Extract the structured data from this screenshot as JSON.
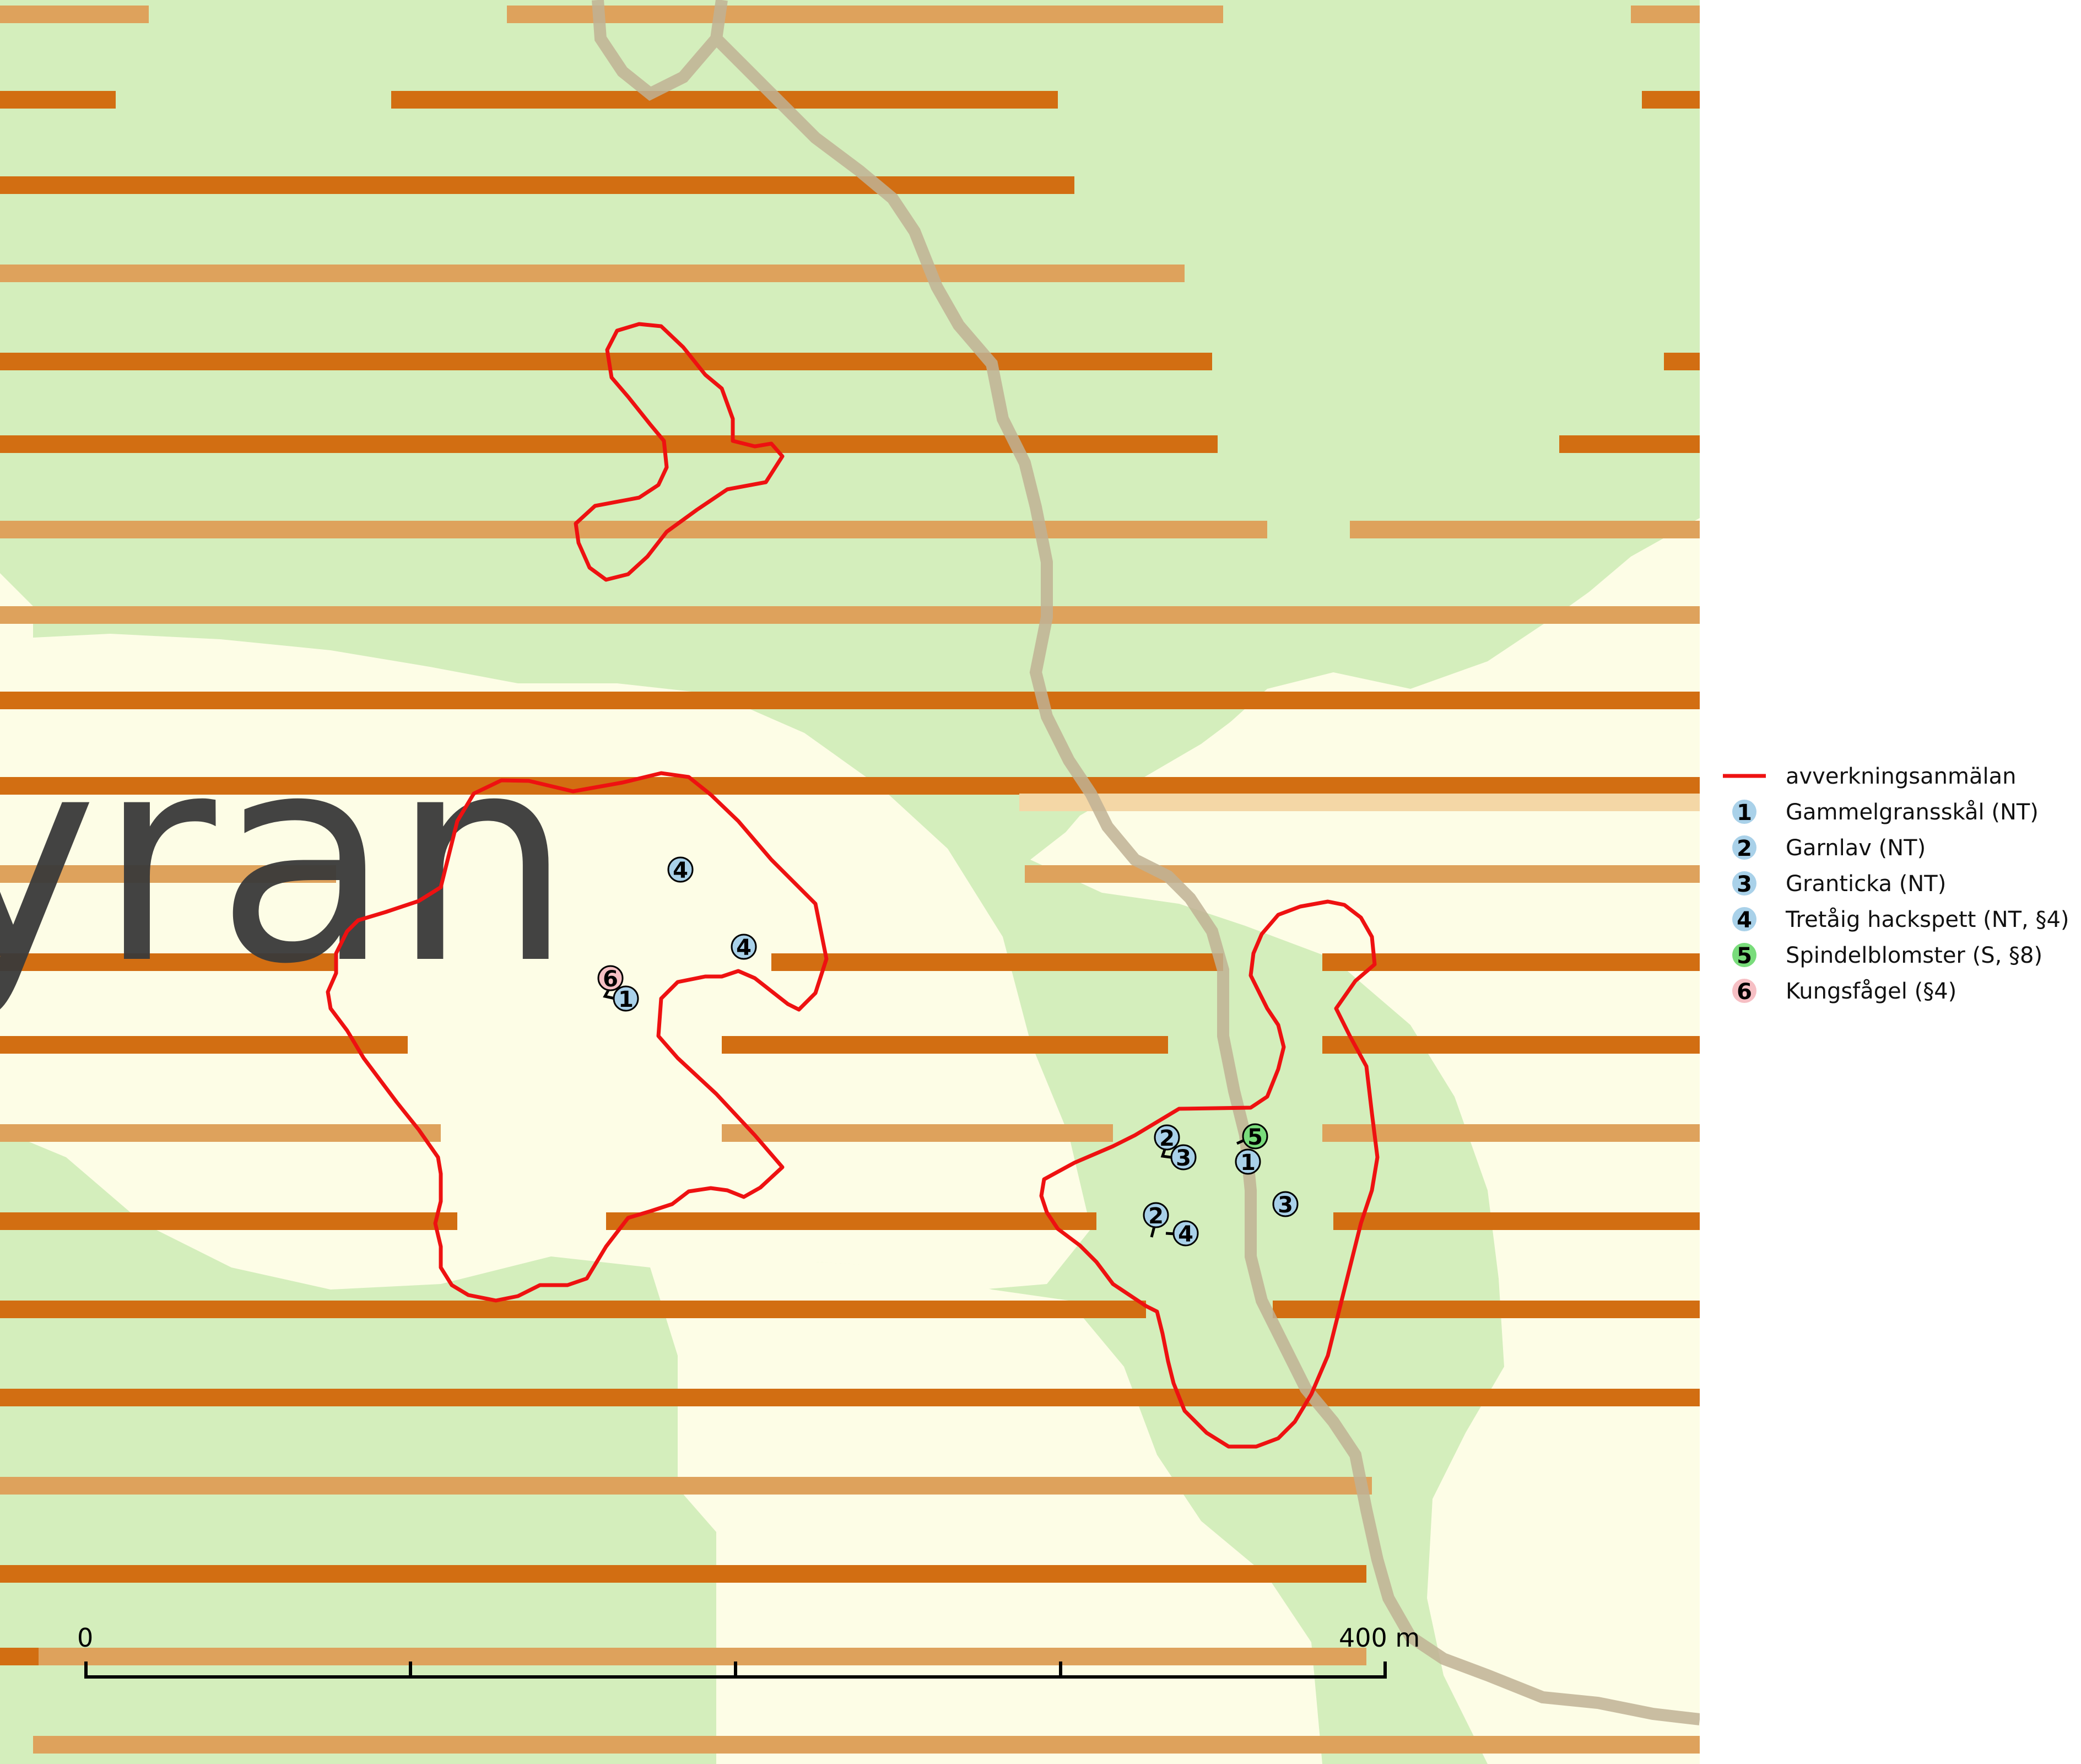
{
  "map": {
    "place_label": "yran",
    "colors": {
      "forest": "#d4eebc",
      "open": "#fdfde6",
      "stripe_dark": "#d26e12",
      "stripe_light": "#dea25c",
      "stripe_pale": "#f4d7a6",
      "path": "#c0b294",
      "boundary": "#ee1111"
    }
  },
  "legend": {
    "items": [
      {
        "symbol": "line",
        "label": "avverkningsanmälan",
        "color": "#ee1111"
      },
      {
        "symbol": "1",
        "label": "Gammelgransskål (NT)",
        "color": "#a9d1e9"
      },
      {
        "symbol": "2",
        "label": "Garnlav (NT)",
        "color": "#a9d1e9"
      },
      {
        "symbol": "3",
        "label": "Granticka (NT)",
        "color": "#a9d1e9"
      },
      {
        "symbol": "4",
        "label": "Tretåig hackspett (NT, §4)",
        "color": "#a9d1e9"
      },
      {
        "symbol": "5",
        "label": "Spindelblomster (S, §8)",
        "color": "#79dc7b"
      },
      {
        "symbol": "6",
        "label": "Kungsfågel (§4)",
        "color": "#f6bfc4"
      }
    ]
  },
  "markers": [
    {
      "number": "4",
      "color": "#a9d1e9"
    },
    {
      "number": "4",
      "color": "#a9d1e9"
    },
    {
      "number": "6",
      "color": "#f6bfc4"
    },
    {
      "number": "1",
      "color": "#a9d1e9"
    },
    {
      "number": "2",
      "color": "#a9d1e9"
    },
    {
      "number": "3",
      "color": "#a9d1e9"
    },
    {
      "number": "5",
      "color": "#79dc7b"
    },
    {
      "number": "1",
      "color": "#a9d1e9"
    },
    {
      "number": "3",
      "color": "#a9d1e9"
    },
    {
      "number": "2",
      "color": "#a9d1e9"
    },
    {
      "number": "4",
      "color": "#a9d1e9"
    }
  ],
  "scale_bar": {
    "start_label": "0",
    "end_label": "400 m"
  }
}
